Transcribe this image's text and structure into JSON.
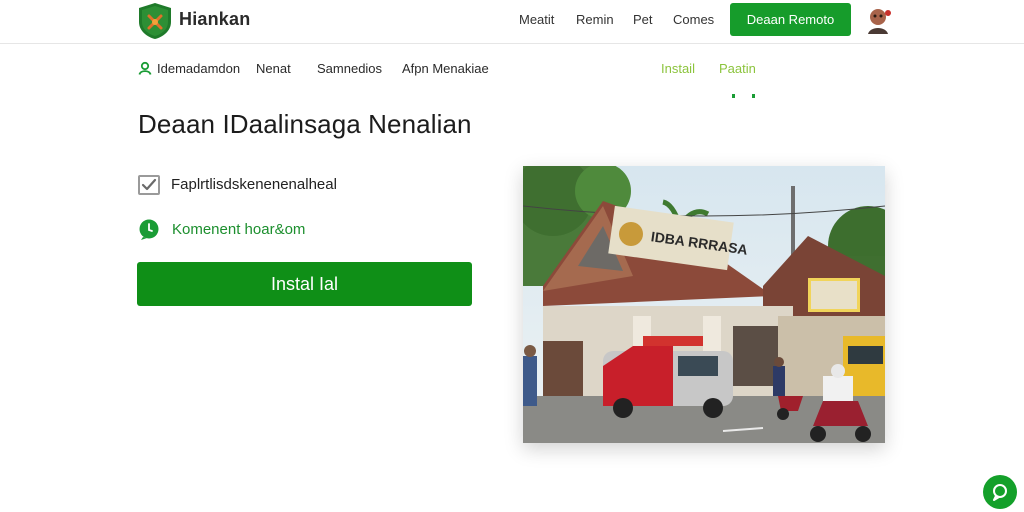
{
  "header": {
    "brand": "Hiankan",
    "nav": [
      "Meatit",
      "Remin",
      "Pet",
      "Comes"
    ],
    "cta": "Deaan Remoto"
  },
  "subnav": {
    "items": [
      "Idemadamdon",
      "Nenat",
      "Samnedios",
      "Afpn Menakiae"
    ],
    "green_items": [
      "Instail",
      "Paatin"
    ]
  },
  "main": {
    "headline": "Deaan IDaalinsaga Nenalian",
    "checkbox_label": "Faplrtlisdskenenenalheal",
    "chat_label": "Komenent hoar&om",
    "install_label": "Instal Ial"
  },
  "photo": {
    "sign_text": "IDBA RRRASA"
  },
  "colors": {
    "brand_green": "#169c2b",
    "install_green": "#0f8f17",
    "accent_yellow_green": "#8cc43d"
  },
  "icons": {
    "logo": "shield-logo-icon",
    "avatar": "user-avatar-icon",
    "subnav_user": "user-icon",
    "check": "checkmark-icon",
    "chat": "chat-bubble-icon",
    "fab": "support-chat-icon"
  }
}
